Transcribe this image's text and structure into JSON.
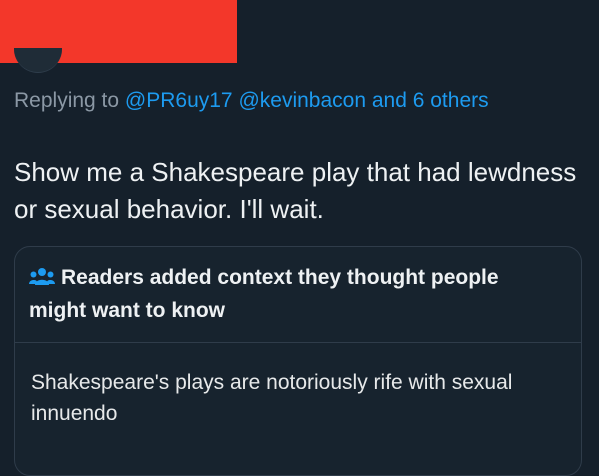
{
  "reply": {
    "prefix": "Replying to",
    "mentions": "@PR6uy17 @kevinbacon",
    "others": "and 6 others"
  },
  "tweet": {
    "text": "Show me a Shakespeare play that had lewdness or sexual behavior. I'll wait."
  },
  "community_note": {
    "icon": "people-icon",
    "heading": "Readers added context they thought people might want to know",
    "body": "Shakespeare's plays are notoriously rife with sexual innuendo"
  },
  "colors": {
    "background": "#15202b",
    "link": "#1d9bf0",
    "redaction": "#f3372a"
  }
}
